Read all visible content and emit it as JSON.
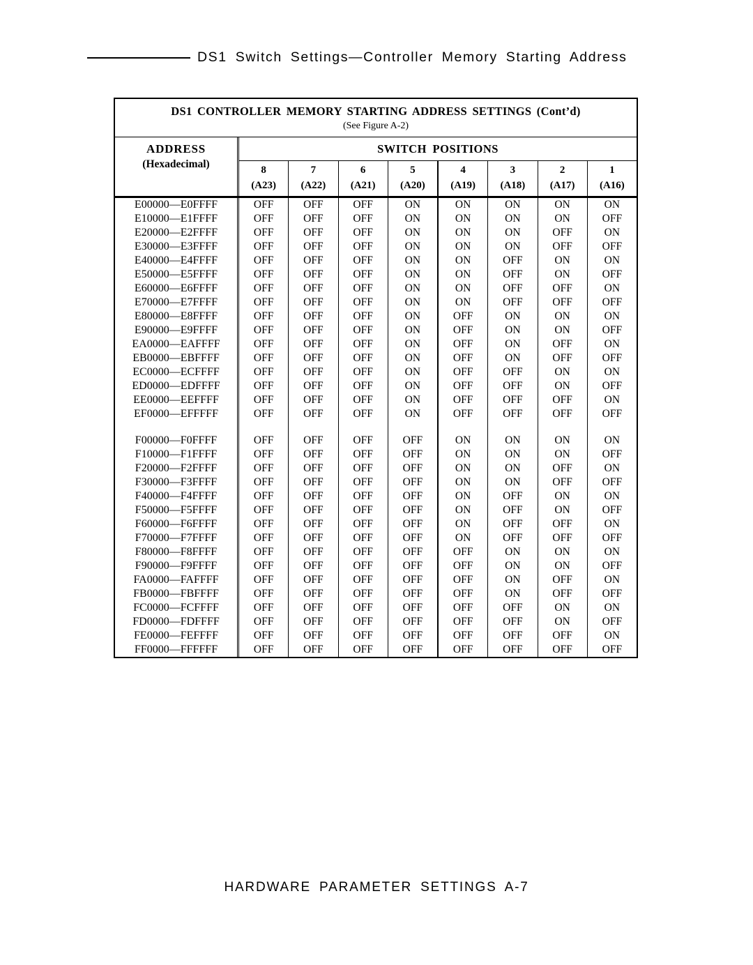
{
  "running_head": {
    "text": "DS1 Switch Settings—Controller Memory Starting Address"
  },
  "table": {
    "caption_title": "DS1 CONTROLLER MEMORY STARTING ADDRESS SETTINGS (Cont’d)",
    "caption_subtitle": "(See Figure A-2)",
    "address_header_line1": "ADDRESS",
    "address_header_line2": "(Hexadecimal)",
    "switch_group_header": "SWITCH  POSITIONS",
    "switch_columns": [
      {
        "number": "8",
        "bit": "(A23)"
      },
      {
        "number": "7",
        "bit": "(A22)"
      },
      {
        "number": "6",
        "bit": "(A21)"
      },
      {
        "number": "5",
        "bit": "(A20)"
      },
      {
        "number": "4",
        "bit": "(A19)"
      },
      {
        "number": "3",
        "bit": "(A18)"
      },
      {
        "number": "2",
        "bit": "(A17)"
      },
      {
        "number": "1",
        "bit": "(A16)"
      }
    ],
    "rows": [
      {
        "address": "E00000—E0FFFF",
        "switches": [
          "OFF",
          "OFF",
          "OFF",
          "ON",
          "ON",
          "ON",
          "ON",
          "ON"
        ]
      },
      {
        "address": "E10000—E1FFFF",
        "switches": [
          "OFF",
          "OFF",
          "OFF",
          "ON",
          "ON",
          "ON",
          "ON",
          "OFF"
        ]
      },
      {
        "address": "E20000—E2FFFF",
        "switches": [
          "OFF",
          "OFF",
          "OFF",
          "ON",
          "ON",
          "ON",
          "OFF",
          "ON"
        ]
      },
      {
        "address": "E30000—E3FFFF",
        "switches": [
          "OFF",
          "OFF",
          "OFF",
          "ON",
          "ON",
          "ON",
          "OFF",
          "OFF"
        ]
      },
      {
        "address": "E40000—E4FFFF",
        "switches": [
          "OFF",
          "OFF",
          "OFF",
          "ON",
          "ON",
          "OFF",
          "ON",
          "ON"
        ]
      },
      {
        "address": "E50000—E5FFFF",
        "switches": [
          "OFF",
          "OFF",
          "OFF",
          "ON",
          "ON",
          "OFF",
          "ON",
          "OFF"
        ]
      },
      {
        "address": "E60000—E6FFFF",
        "switches": [
          "OFF",
          "OFF",
          "OFF",
          "ON",
          "ON",
          "OFF",
          "OFF",
          "ON"
        ]
      },
      {
        "address": "E70000—E7FFFF",
        "switches": [
          "OFF",
          "OFF",
          "OFF",
          "ON",
          "ON",
          "OFF",
          "OFF",
          "OFF"
        ]
      },
      {
        "address": "E80000—E8FFFF",
        "switches": [
          "OFF",
          "OFF",
          "OFF",
          "ON",
          "OFF",
          "ON",
          "ON",
          "ON"
        ]
      },
      {
        "address": "E90000—E9FFFF",
        "switches": [
          "OFF",
          "OFF",
          "OFF",
          "ON",
          "OFF",
          "ON",
          "ON",
          "OFF"
        ]
      },
      {
        "address": "EA0000—EAFFFF",
        "switches": [
          "OFF",
          "OFF",
          "OFF",
          "ON",
          "OFF",
          "ON",
          "OFF",
          "ON"
        ]
      },
      {
        "address": "EB0000—EBFFFF",
        "switches": [
          "OFF",
          "OFF",
          "OFF",
          "ON",
          "OFF",
          "ON",
          "OFF",
          "OFF"
        ]
      },
      {
        "address": "EC0000—ECFFFF",
        "switches": [
          "OFF",
          "OFF",
          "OFF",
          "ON",
          "OFF",
          "OFF",
          "ON",
          "ON"
        ]
      },
      {
        "address": "ED0000—EDFFFF",
        "switches": [
          "OFF",
          "OFF",
          "OFF",
          "ON",
          "OFF",
          "OFF",
          "ON",
          "OFF"
        ]
      },
      {
        "address": "EE0000—EEFFFF",
        "switches": [
          "OFF",
          "OFF",
          "OFF",
          "ON",
          "OFF",
          "OFF",
          "OFF",
          "ON"
        ]
      },
      {
        "address": "EF0000—EFFFFF",
        "switches": [
          "OFF",
          "OFF",
          "OFF",
          "ON",
          "OFF",
          "OFF",
          "OFF",
          "OFF"
        ]
      },
      {
        "spacer": true
      },
      {
        "address": "F00000—F0FFFF",
        "switches": [
          "OFF",
          "OFF",
          "OFF",
          "OFF",
          "ON",
          "ON",
          "ON",
          "ON"
        ]
      },
      {
        "address": "F10000—F1FFFF",
        "switches": [
          "OFF",
          "OFF",
          "OFF",
          "OFF",
          "ON",
          "ON",
          "ON",
          "OFF"
        ]
      },
      {
        "address": "F20000—F2FFFF",
        "switches": [
          "OFF",
          "OFF",
          "OFF",
          "OFF",
          "ON",
          "ON",
          "OFF",
          "ON"
        ]
      },
      {
        "address": "F30000—F3FFFF",
        "switches": [
          "OFF",
          "OFF",
          "OFF",
          "OFF",
          "ON",
          "ON",
          "OFF",
          "OFF"
        ]
      },
      {
        "address": "F40000—F4FFFF",
        "switches": [
          "OFF",
          "OFF",
          "OFF",
          "OFF",
          "ON",
          "OFF",
          "ON",
          "ON"
        ]
      },
      {
        "address": "F50000—F5FFFF",
        "switches": [
          "OFF",
          "OFF",
          "OFF",
          "OFF",
          "ON",
          "OFF",
          "ON",
          "OFF"
        ]
      },
      {
        "address": "F60000—F6FFFF",
        "switches": [
          "OFF",
          "OFF",
          "OFF",
          "OFF",
          "ON",
          "OFF",
          "OFF",
          "ON"
        ]
      },
      {
        "address": "F70000—F7FFFF",
        "switches": [
          "OFF",
          "OFF",
          "OFF",
          "OFF",
          "ON",
          "OFF",
          "OFF",
          "OFF"
        ]
      },
      {
        "address": "F80000—F8FFFF",
        "switches": [
          "OFF",
          "OFF",
          "OFF",
          "OFF",
          "OFF",
          "ON",
          "ON",
          "ON"
        ]
      },
      {
        "address": "F90000—F9FFFF",
        "switches": [
          "OFF",
          "OFF",
          "OFF",
          "OFF",
          "OFF",
          "ON",
          "ON",
          "OFF"
        ]
      },
      {
        "address": "FA0000—FAFFFF",
        "switches": [
          "OFF",
          "OFF",
          "OFF",
          "OFF",
          "OFF",
          "ON",
          "OFF",
          "ON"
        ]
      },
      {
        "address": "FB0000—FBFFFF",
        "switches": [
          "OFF",
          "OFF",
          "OFF",
          "OFF",
          "OFF",
          "ON",
          "OFF",
          "OFF"
        ]
      },
      {
        "address": "FC0000—FCFFFF",
        "switches": [
          "OFF",
          "OFF",
          "OFF",
          "OFF",
          "OFF",
          "OFF",
          "ON",
          "ON"
        ]
      },
      {
        "address": "FD0000—FDFFFF",
        "switches": [
          "OFF",
          "OFF",
          "OFF",
          "OFF",
          "OFF",
          "OFF",
          "ON",
          "OFF"
        ]
      },
      {
        "address": "FE0000—FEFFFF",
        "switches": [
          "OFF",
          "OFF",
          "OFF",
          "OFF",
          "OFF",
          "OFF",
          "OFF",
          "ON"
        ]
      },
      {
        "address": "FF0000—FFFFFF",
        "switches": [
          "OFF",
          "OFF",
          "OFF",
          "OFF",
          "OFF",
          "OFF",
          "OFF",
          "OFF"
        ]
      }
    ]
  },
  "footer": {
    "text": "HARDWARE  PARAMETER  SETTINGS   A-7"
  }
}
